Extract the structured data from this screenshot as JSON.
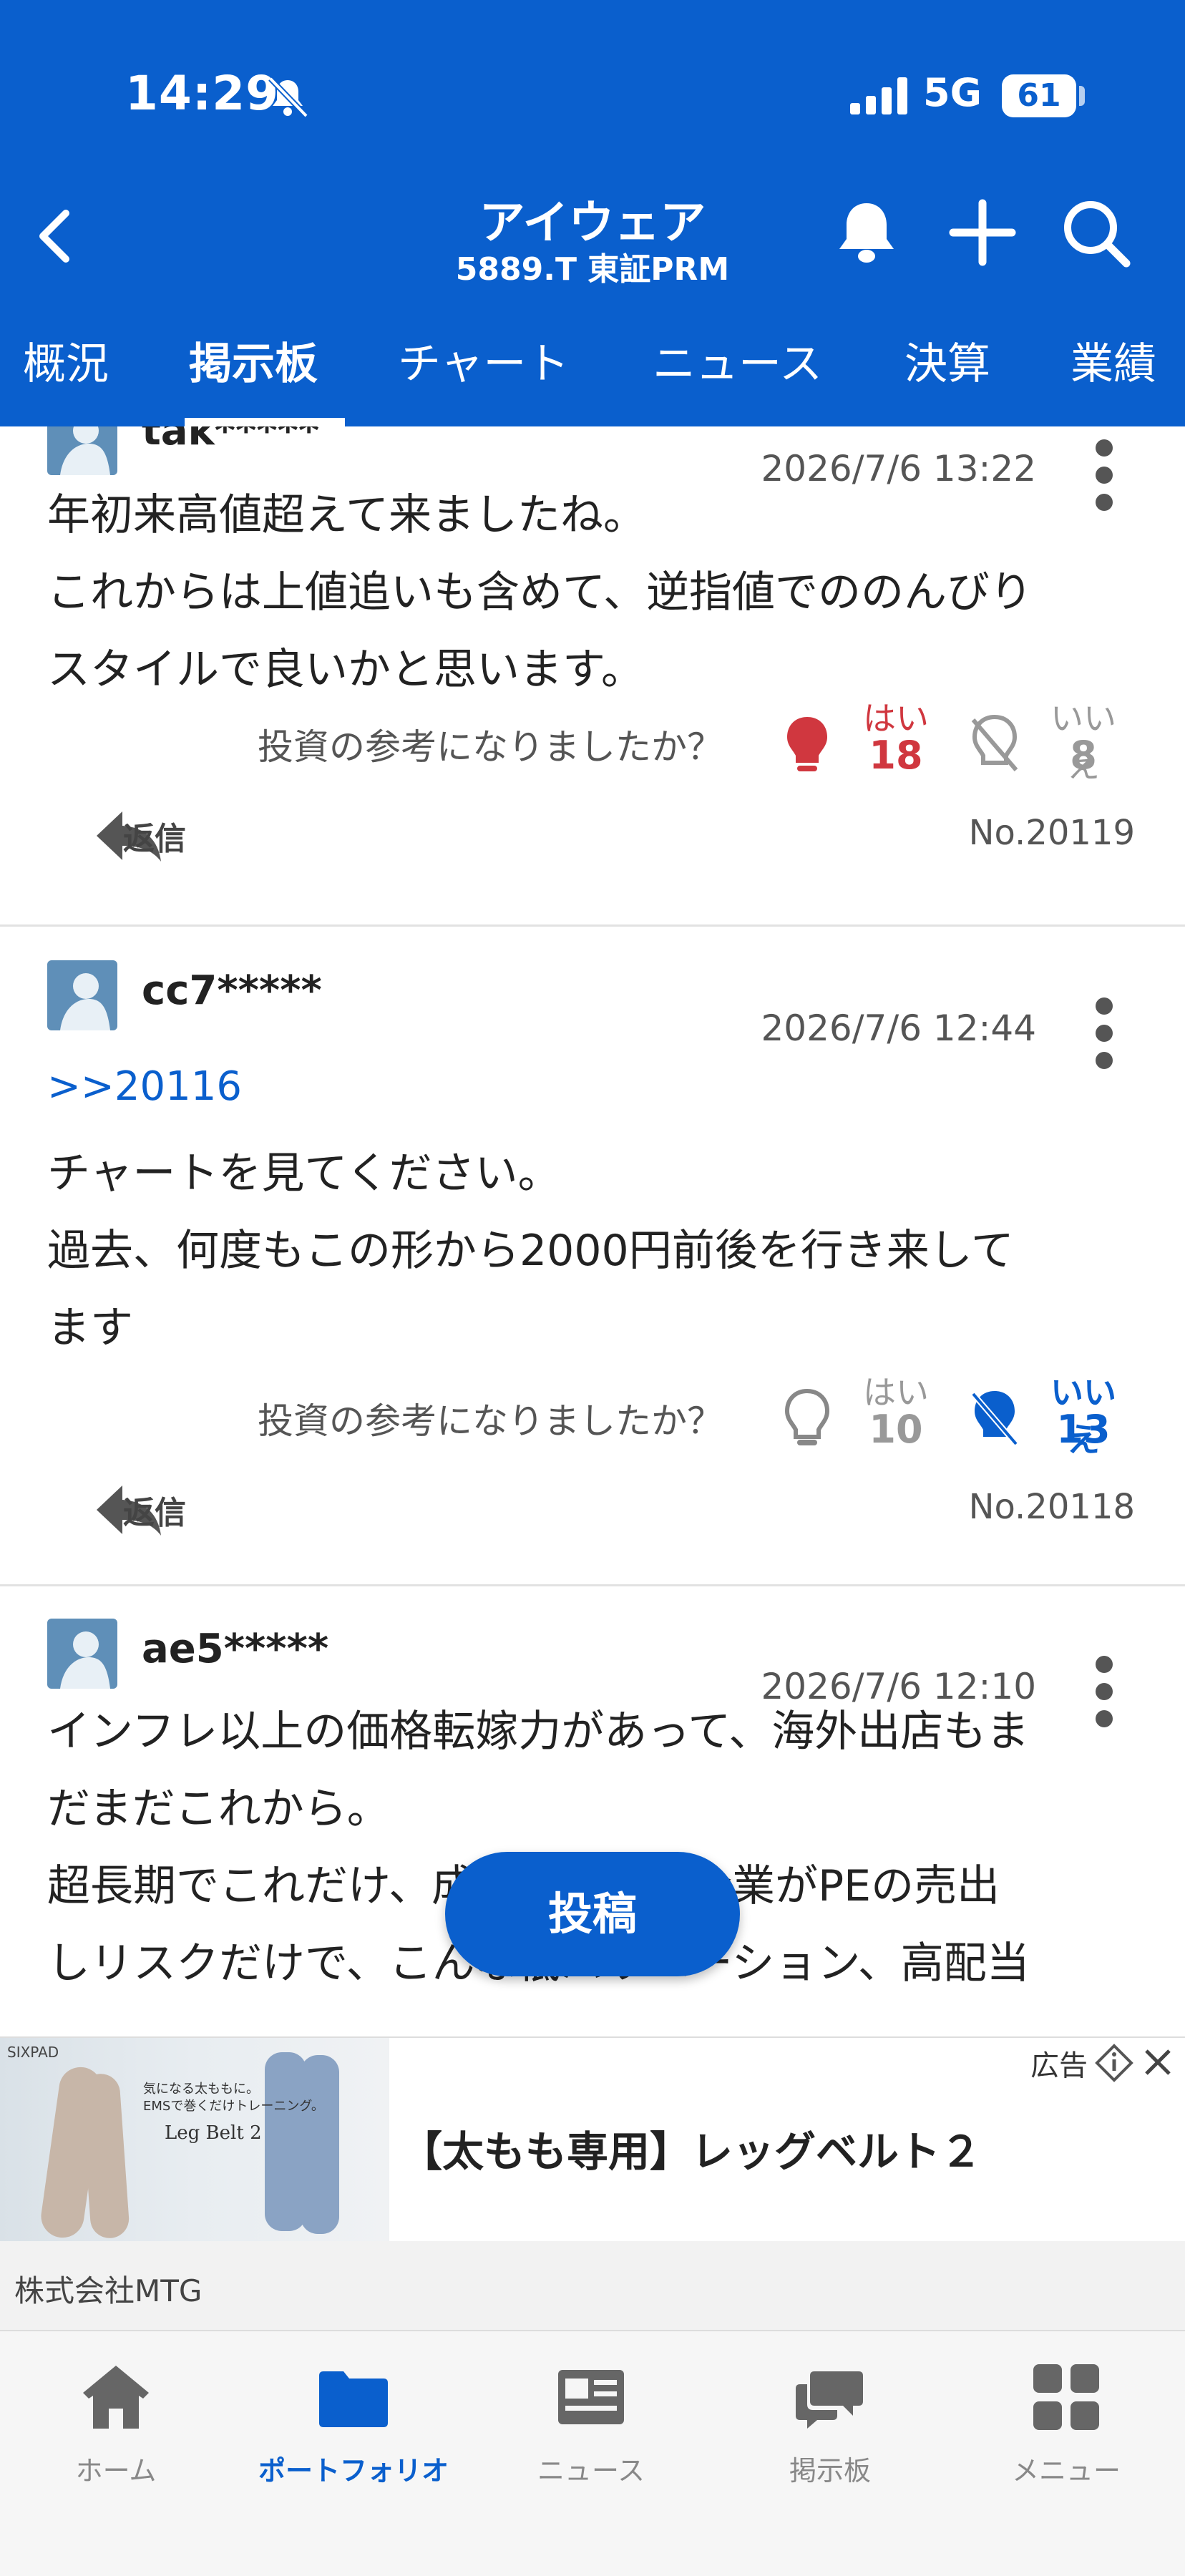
{
  "status_bar": {
    "time": "14:29",
    "network": "5G",
    "battery": "61"
  },
  "header": {
    "title": "アイウェア",
    "subtitle": "5889.T 東証PRM",
    "icons": {
      "back": "chevron-left-icon",
      "bell": "bell-icon",
      "add": "plus-icon",
      "search": "search-icon"
    }
  },
  "tabs": [
    {
      "label": "概況"
    },
    {
      "label": "掲示板",
      "active": true
    },
    {
      "label": "チャート"
    },
    {
      "label": "ニュース"
    },
    {
      "label": "決算"
    },
    {
      "label": "業績"
    }
  ],
  "helpful_question": "投資の参考になりましたか？",
  "vote_labels": {
    "yes": "はい",
    "no": "いいえ"
  },
  "reply_label": "返信",
  "posts": [
    {
      "user": "tak*****",
      "date": "2026/7/6 13:22",
      "reply_to": "",
      "lines": [
        "年初来高値超えて来ましたね。",
        "これからは上値追いも含めて、逆指値でののんびり",
        "スタイルで良いかと思います。"
      ],
      "yes": "18",
      "no": "8",
      "voted": "yes",
      "number": "No.20119"
    },
    {
      "user": "cc7*****",
      "date": "2026/7/6 12:44",
      "reply_to": ">>20116",
      "lines": [
        "チャートを見てください。",
        "過去、何度もこの形から2000円前後を行き来して",
        "ます"
      ],
      "yes": "10",
      "no": "13",
      "voted": "no",
      "number": "No.20118"
    },
    {
      "user": "ae5*****",
      "date": "2026/7/6 12:10",
      "reply_to": "",
      "lines": [
        "インフレ以上の価格転嫁力があって、海外出店もま",
        "だまだこれから。",
        "超長期でこれだけ、成長性の高い企業がPEの売出",
        "しリスクだけで、こんな低バリエーション、高配当"
      ],
      "yes": "",
      "no": "",
      "voted": "",
      "number": ""
    }
  ],
  "post_button": "投稿",
  "ad": {
    "label": "広告",
    "title": "【太もも専用】レッグベルト２",
    "advertiser": "株式会社MTG",
    "brand": "SIXPAD",
    "copy": [
      "気になる太ももに。",
      "EMSで巻くだけトレーニング。"
    ],
    "product": "Leg Belt 2"
  },
  "bottom_nav": [
    {
      "label": "ホーム",
      "icon": "home-icon"
    },
    {
      "label": "ポートフォリオ",
      "icon": "folder-icon",
      "active": true
    },
    {
      "label": "ニュース",
      "icon": "newspaper-icon"
    },
    {
      "label": "掲示板",
      "icon": "chat-bubbles-icon"
    },
    {
      "label": "メニュー",
      "icon": "grid-icon"
    }
  ],
  "colors": {
    "primary": "#0a5fcd",
    "yes_active": "#d0373f",
    "no_active": "#0a5fcd",
    "inactive": "#999999"
  }
}
